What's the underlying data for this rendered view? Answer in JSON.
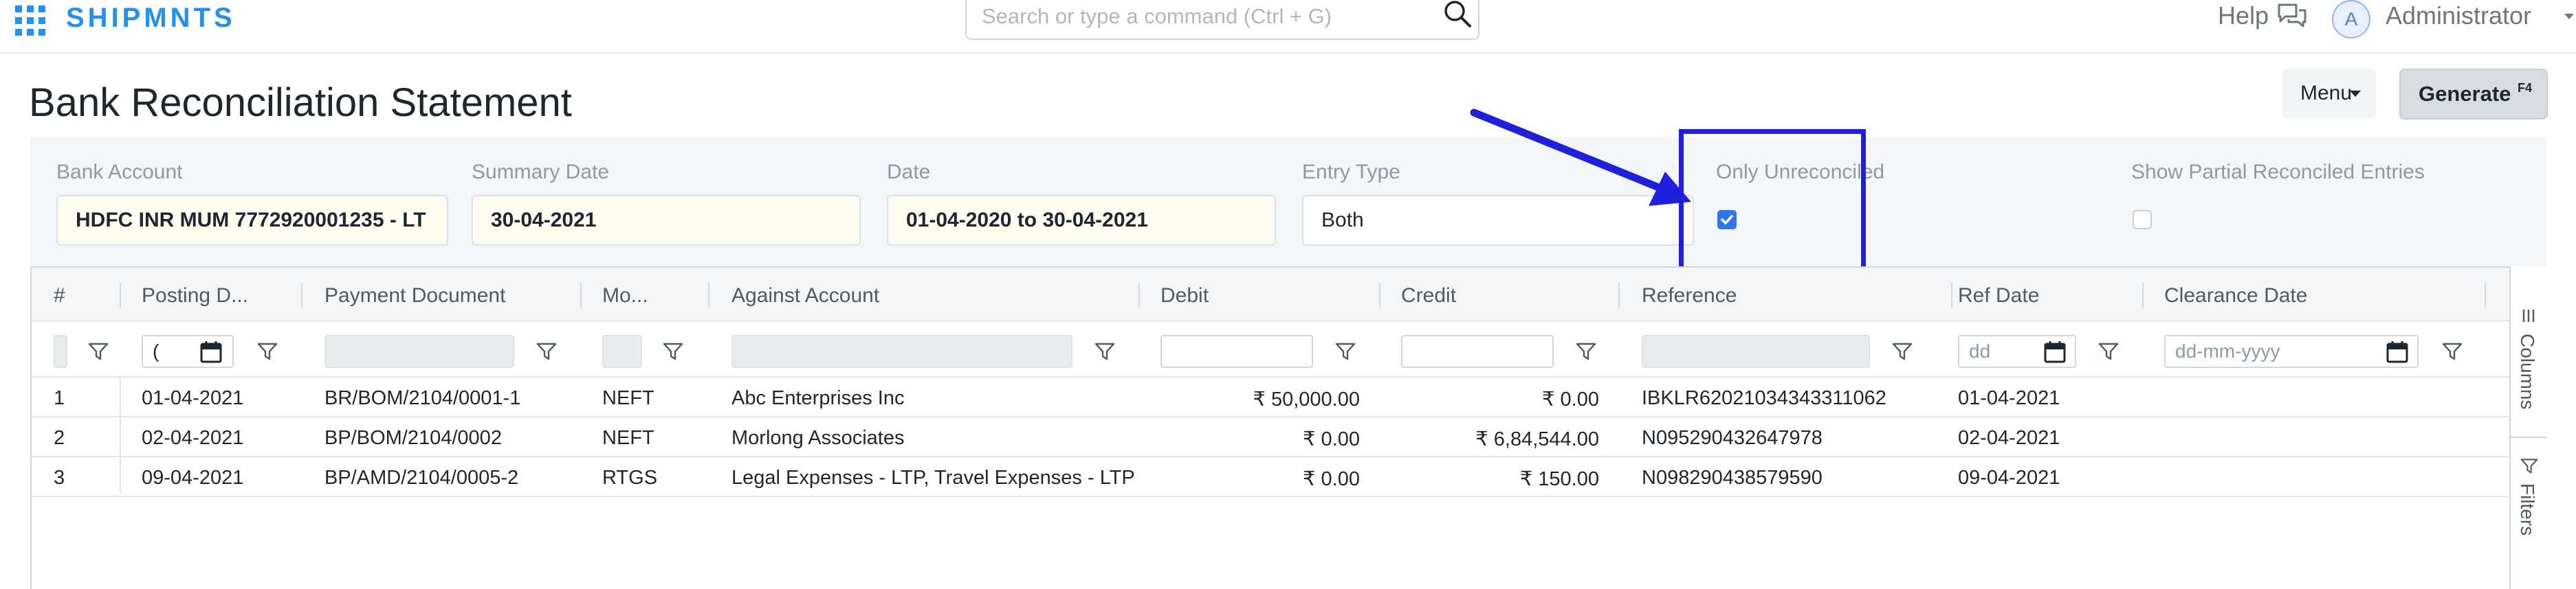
{
  "navbar": {
    "brand": "SHIPMNTS",
    "search_placeholder": "Search or type a command (Ctrl + G)",
    "help_label": "Help",
    "avatar_initial": "A",
    "user_label": "Administrator"
  },
  "page": {
    "title": "Bank Reconciliation Statement",
    "menu_label": "Menu",
    "generate_label": "Generate",
    "generate_shortcut": "F4"
  },
  "filters": {
    "bank_account": {
      "label": "Bank Account",
      "value": "HDFC INR MUM 7772920001235 - LT"
    },
    "summary_date": {
      "label": "Summary Date",
      "value": "30-04-2021"
    },
    "date": {
      "label": "Date",
      "value": "01-04-2020 to 30-04-2021"
    },
    "entry_type": {
      "label": "Entry Type",
      "value": "Both"
    },
    "only_unreconciled": {
      "label": "Only Unreconciled",
      "checked": true
    },
    "show_partial": {
      "label": "Show Partial Reconciled Entries",
      "checked": false
    }
  },
  "table": {
    "columns": [
      "#",
      "Posting D...",
      "Payment Document",
      "Mo...",
      "Against Account",
      "Debit",
      "Credit",
      "Reference",
      "Ref Date",
      "Clearance Date"
    ],
    "filter_row": {
      "posting_date_value": "(",
      "ref_date_placeholder": "dd",
      "clearance_placeholder": "dd-mm-yyyy"
    },
    "rows": [
      {
        "idx": "1",
        "posting_date": "01-04-2021",
        "payment_document": "BR/BOM/2104/0001-1",
        "mode": "NEFT",
        "against_account": "Abc Enterprises Inc",
        "debit": "₹ 50,000.00",
        "credit": "₹ 0.00",
        "reference": "IBKLR62021034343311062",
        "ref_date": "01-04-2021",
        "clearance_date": ""
      },
      {
        "idx": "2",
        "posting_date": "02-04-2021",
        "payment_document": "BP/BOM/2104/0002",
        "mode": "NEFT",
        "against_account": "Morlong Associates",
        "debit": "₹ 0.00",
        "credit": "₹ 6,84,544.00",
        "reference": "N095290432647978",
        "ref_date": "02-04-2021",
        "clearance_date": ""
      },
      {
        "idx": "3",
        "posting_date": "09-04-2021",
        "payment_document": "BP/AMD/2104/0005-2",
        "mode": "RTGS",
        "against_account": "Legal Expenses - LTP, Travel Expenses - LTP",
        "debit": "₹ 0.00",
        "credit": "₹ 150.00",
        "reference": "N098290438579590",
        "ref_date": "09-04-2021",
        "clearance_date": ""
      }
    ]
  },
  "side_panel": {
    "columns_label": "Columns",
    "filters_label": "Filters"
  },
  "colors": {
    "brand": "#2490ef",
    "checkbox_checked": "#2e75e6",
    "annotation": "#1f1fdc"
  },
  "icons": [
    "app-grid-icon",
    "search-icon",
    "chat-help-icon",
    "caret-down-icon",
    "funnel-icon",
    "calendar-icon",
    "columns-icon",
    "filter-icon",
    "check-icon",
    "arrow-annotation"
  ]
}
